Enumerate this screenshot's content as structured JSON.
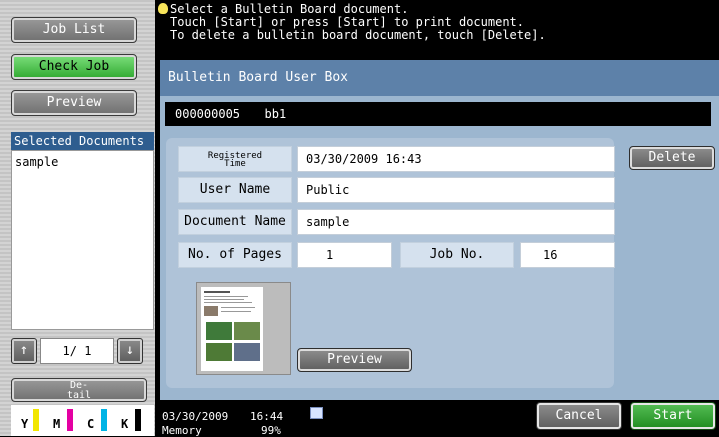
{
  "left": {
    "job_list": "Job List",
    "check_job": "Check Job",
    "preview": "Preview",
    "selected_header": "Selected Documents",
    "selected_items": [
      "sample"
    ],
    "page_indicator": "1/  1",
    "detail": "De-\ntail",
    "toner": [
      "Y",
      "M",
      "C",
      "K"
    ]
  },
  "colors": {
    "yellow": "#f2e600",
    "magenta": "#e400a2",
    "cyan": "#00b4e6",
    "black": "#000000",
    "accent_green": "#2fa82f"
  },
  "message": {
    "line1": "Select a Bulletin Board document.",
    "line2": "Touch [Start] or press [Start] to print document.",
    "line3": "To delete a bulletin board document, touch [Delete]."
  },
  "panel": {
    "title": "Bulletin Board User Box",
    "box_id": "000000005",
    "box_name": "bb1",
    "fields": {
      "registered_time_label": "Registered\nTime",
      "registered_time": "03/30/2009 16:43",
      "user_name_label": "User Name",
      "user_name": "Public",
      "document_name_label": "Document Name",
      "document_name": "sample",
      "pages_label": "No. of Pages",
      "pages": "1",
      "job_no_label": "Job No.",
      "job_no": "16"
    },
    "delete": "Delete",
    "preview": "Preview"
  },
  "bottom": {
    "date": "03/30/2009",
    "time": "16:44",
    "memory_label": "Memory",
    "memory_value": "99%",
    "cancel": "Cancel",
    "start": "Start"
  }
}
